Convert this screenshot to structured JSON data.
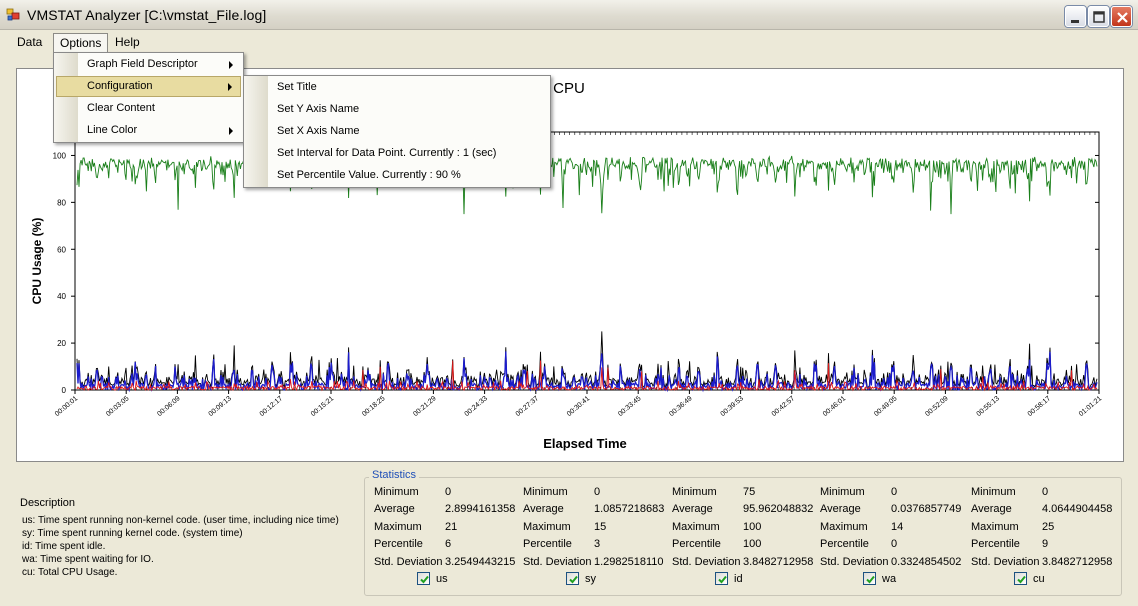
{
  "window": {
    "title": "VMSTAT Analyzer [C:\\vmstat_File.log]",
    "icon": "app-icon"
  },
  "menubar": {
    "items": [
      "Data",
      "Options",
      "Help"
    ],
    "open_menu": "Options"
  },
  "options_menu": {
    "items": [
      {
        "label": "Graph Field Descriptor",
        "has_submenu": true
      },
      {
        "label": "Configuration",
        "has_submenu": true,
        "highlighted": true
      },
      {
        "label": "Clear Content",
        "has_submenu": false
      },
      {
        "label": "Line Color",
        "has_submenu": true
      }
    ]
  },
  "configuration_submenu": {
    "items": [
      "Set Title",
      "Set Y Axis Name",
      "Set X Axis Name",
      "Set Interval for Data Point. Currently : 1 (sec)",
      "Set Percentile Value. Currently : 90 %"
    ]
  },
  "chart_data": {
    "type": "line",
    "title": "CPU",
    "xlabel": "Elapsed Time",
    "ylabel": "CPU Usage (%)",
    "ylim": [
      0,
      110
    ],
    "yticks": [
      0,
      20,
      40,
      60,
      80,
      100
    ],
    "xticks": [
      "00:00:01",
      "00:03:05",
      "00:06:09",
      "00:09:13",
      "00:12:17",
      "00:15:21",
      "00:18:25",
      "00:21:29",
      "00:24:33",
      "00:27:37",
      "00:30:41",
      "00:33:45",
      "00:36:49",
      "00:39:53",
      "00:42:57",
      "00:46:01",
      "00:49:05",
      "00:52:09",
      "00:55:13",
      "00:58:17",
      "01:01:21"
    ],
    "grid": false,
    "series": [
      {
        "name": "id",
        "color": "#1a7f1a",
        "approx_mean": 96,
        "approx_min": 75,
        "approx_max": 100
      },
      {
        "name": "cu",
        "color": "#000000",
        "approx_mean": 4,
        "approx_min": 0,
        "approx_max": 25
      },
      {
        "name": "us",
        "color": "#1c1ccc",
        "approx_mean": 2.9,
        "approx_min": 0,
        "approx_max": 21
      },
      {
        "name": "sy",
        "color": "#e01818",
        "approx_mean": 1.1,
        "approx_min": 0,
        "approx_max": 15
      }
    ]
  },
  "description": {
    "title": "Description",
    "lines": [
      "us: Time spent running non-kernel code. (user time, including nice time)",
      "sy: Time spent running kernel code. (system time)",
      "id: Time spent idle.",
      "wa: Time spent waiting for IO.",
      "cu: Total CPU Usage."
    ]
  },
  "statistics": {
    "legend": "Statistics",
    "row_labels": [
      "Minimum",
      "Average",
      "Maximum",
      "Percentile",
      "Std. Deviation"
    ],
    "columns": [
      {
        "name": "us",
        "checked": true,
        "values": [
          "0",
          "2.8994161358",
          "21",
          "6",
          "3.2549443215"
        ]
      },
      {
        "name": "sy",
        "checked": true,
        "values": [
          "0",
          "1.0857218683",
          "15",
          "3",
          "1.2982518110"
        ]
      },
      {
        "name": "id",
        "checked": true,
        "values": [
          "75",
          "95.962048832",
          "100",
          "100",
          "3.8482712958"
        ]
      },
      {
        "name": "wa",
        "checked": true,
        "values": [
          "0",
          "0.0376857749",
          "14",
          "0",
          "0.3324854502"
        ]
      },
      {
        "name": "cu",
        "checked": true,
        "values": [
          "0",
          "4.0644904458",
          "25",
          "9",
          "3.8482712958"
        ]
      }
    ]
  }
}
